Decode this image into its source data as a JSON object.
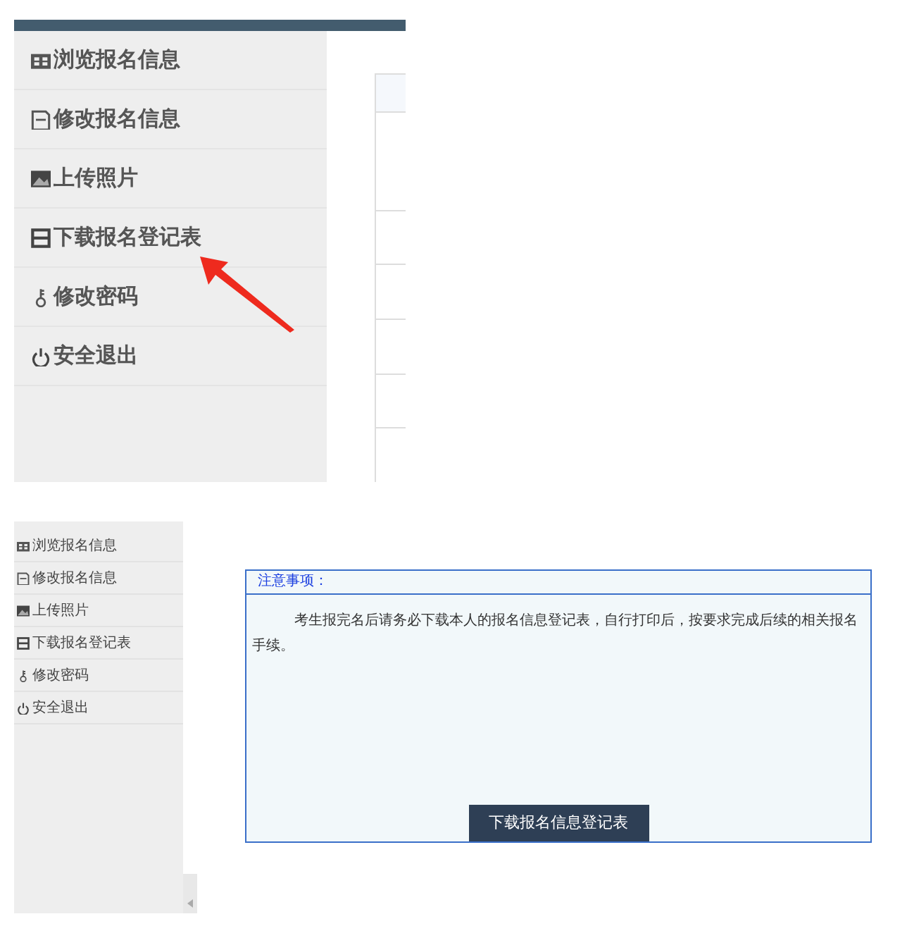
{
  "top_panel": {
    "menu": [
      {
        "label": "浏览报名信息"
      },
      {
        "label": "修改报名信息"
      },
      {
        "label": "上传照片"
      },
      {
        "label": "下载报名登记表"
      },
      {
        "label": "修改密码"
      },
      {
        "label": "安全退出"
      }
    ]
  },
  "bottom_panel": {
    "menu": [
      {
        "label": "浏览报名信息"
      },
      {
        "label": "修改报名信息"
      },
      {
        "label": "上传照片"
      },
      {
        "label": "下载报名登记表"
      },
      {
        "label": "修改密码"
      },
      {
        "label": "安全退出"
      }
    ],
    "notice": {
      "title": "注意事项：",
      "text": "考生报完名后请务必下载本人的报名信息登记表，自行打印后，按要求完成后续的相关报名手续。"
    },
    "button": "下载报名信息登记表"
  }
}
